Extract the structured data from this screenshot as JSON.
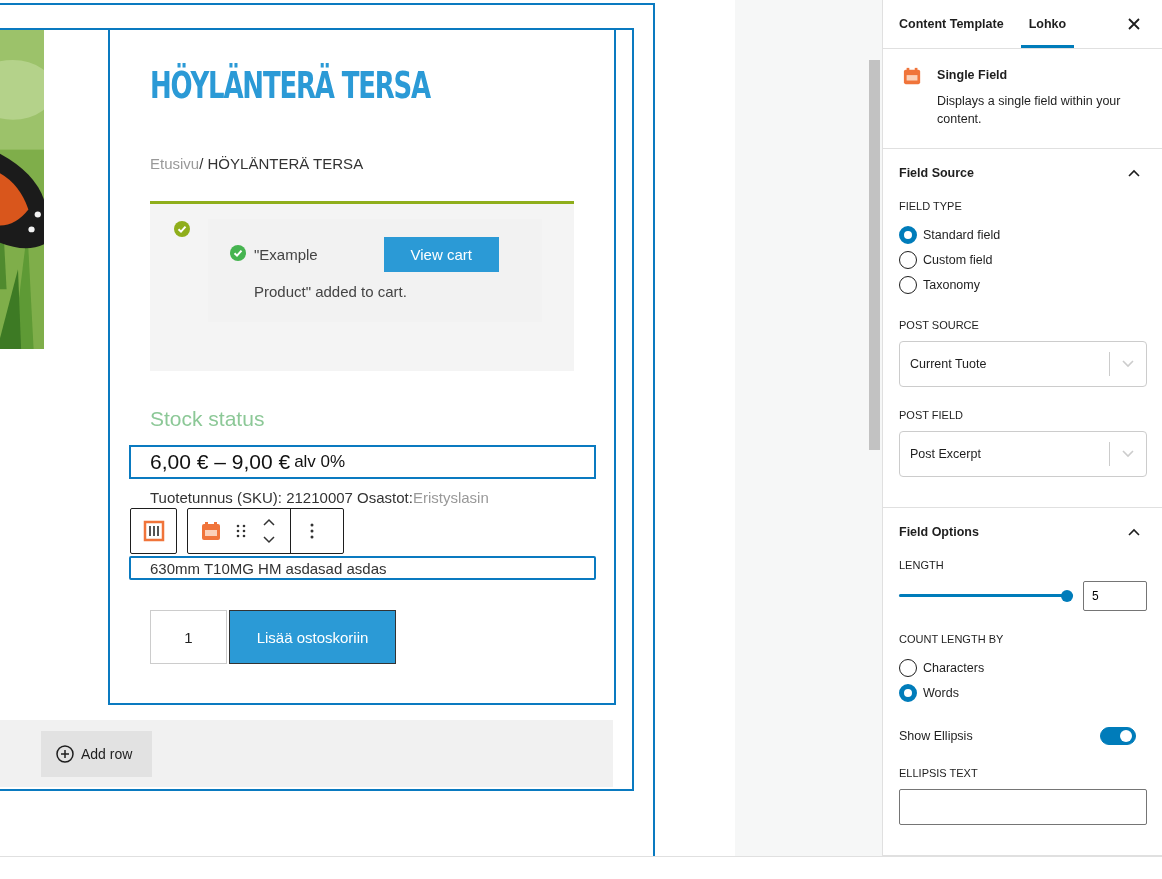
{
  "canvas": {
    "title": "HÖYLÄNTERÄ TERSA",
    "breadcrumb": {
      "home": "Etusivu",
      "current": "/ HÖYLÄNTERÄ TERSA"
    },
    "notice": {
      "line_1": "\"Example",
      "line_2": "Product\" added to cart.",
      "button": "View cart"
    },
    "stock_status": "Stock status",
    "price": {
      "range": "6,00 € – 9,00 €",
      "suffix": "alv 0%"
    },
    "meta": {
      "label": "Tuotetunnus (SKU): 21210007 Osastot:",
      "category": "Eristyslasin"
    },
    "excerpt": "630mm T10MG HM asdasad asdas",
    "quantity": "1",
    "add_button": "Lisää ostoskoriin",
    "add_row": "Add row"
  },
  "sidebar": {
    "tabs": [
      {
        "label": "Content Template",
        "selected": false
      },
      {
        "label": "Lohko",
        "selected": true
      }
    ],
    "block": {
      "title": "Single Field",
      "description": "Displays a single field within your content."
    },
    "panels": [
      {
        "title": "Field Source",
        "expanded": true,
        "controls": [
          {
            "kind": "radio",
            "label": "FIELD TYPE",
            "options": [
              {
                "label": "Standard field",
                "selected": true
              },
              {
                "label": "Custom field",
                "selected": false
              },
              {
                "label": "Taxonomy",
                "selected": false
              }
            ]
          },
          {
            "kind": "select",
            "label": "POST SOURCE",
            "value": "Current Tuote"
          },
          {
            "kind": "select",
            "label": "POST FIELD",
            "value": "Post Excerpt"
          }
        ]
      },
      {
        "title": "Field Options",
        "expanded": true,
        "controls": [
          {
            "kind": "range",
            "label": "LENGTH",
            "level": 1,
            "value": "5"
          },
          {
            "kind": "radio",
            "label": "COUNT LENGTH BY",
            "options": [
              {
                "label": "Characters",
                "selected": false
              },
              {
                "label": "Words",
                "selected": true
              }
            ]
          },
          {
            "kind": "toggle",
            "label": "Show Ellipsis",
            "on": true
          },
          {
            "kind": "text",
            "label": "ELLIPSIS TEXT"
          }
        ]
      }
    ]
  }
}
